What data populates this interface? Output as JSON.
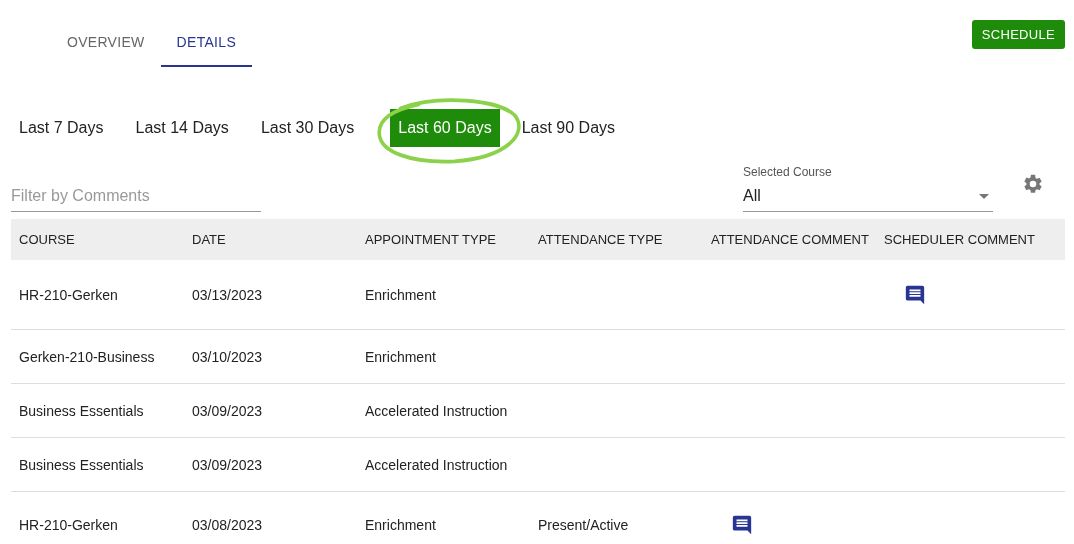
{
  "tabs": [
    {
      "label": "OVERVIEW",
      "selected": false
    },
    {
      "label": "DETAILS",
      "selected": true
    }
  ],
  "schedule_button": "SCHEDULE",
  "ranges": [
    {
      "label": "Last 7 Days",
      "selected": false,
      "circled": false
    },
    {
      "label": "Last 14 Days",
      "selected": false,
      "circled": false
    },
    {
      "label": "Last 30 Days",
      "selected": false,
      "circled": false
    },
    {
      "label": "Last 60 Days",
      "selected": true,
      "circled": true
    },
    {
      "label": "Last 90 Days",
      "selected": false,
      "circled": false
    }
  ],
  "filter": {
    "placeholder": "Filter by Comments"
  },
  "course_select": {
    "label": "Selected Course",
    "value": "All"
  },
  "table": {
    "columns": [
      "COURSE",
      "DATE",
      "APPOINTMENT TYPE",
      "ATTENDANCE TYPE",
      "ATTENDANCE COMMENT",
      "SCHEDULER COMMENT"
    ],
    "rows": [
      {
        "course": "HR-210-Gerken",
        "date": "03/13/2023",
        "appointment_type": "Enrichment",
        "attendance_type": "",
        "attendance_comment": false,
        "scheduler_comment": true
      },
      {
        "course": "Gerken-210-Business",
        "date": "03/10/2023",
        "appointment_type": "Enrichment",
        "attendance_type": "",
        "attendance_comment": false,
        "scheduler_comment": false
      },
      {
        "course": "Business Essentials",
        "date": "03/09/2023",
        "appointment_type": "Accelerated Instruction",
        "attendance_type": "",
        "attendance_comment": false,
        "scheduler_comment": false
      },
      {
        "course": "Business Essentials",
        "date": "03/09/2023",
        "appointment_type": "Accelerated Instruction",
        "attendance_type": "",
        "attendance_comment": false,
        "scheduler_comment": false
      },
      {
        "course": "HR-210-Gerken",
        "date": "03/08/2023",
        "appointment_type": "Enrichment",
        "attendance_type": "Present/Active",
        "attendance_comment": true,
        "scheduler_comment": false
      }
    ]
  }
}
